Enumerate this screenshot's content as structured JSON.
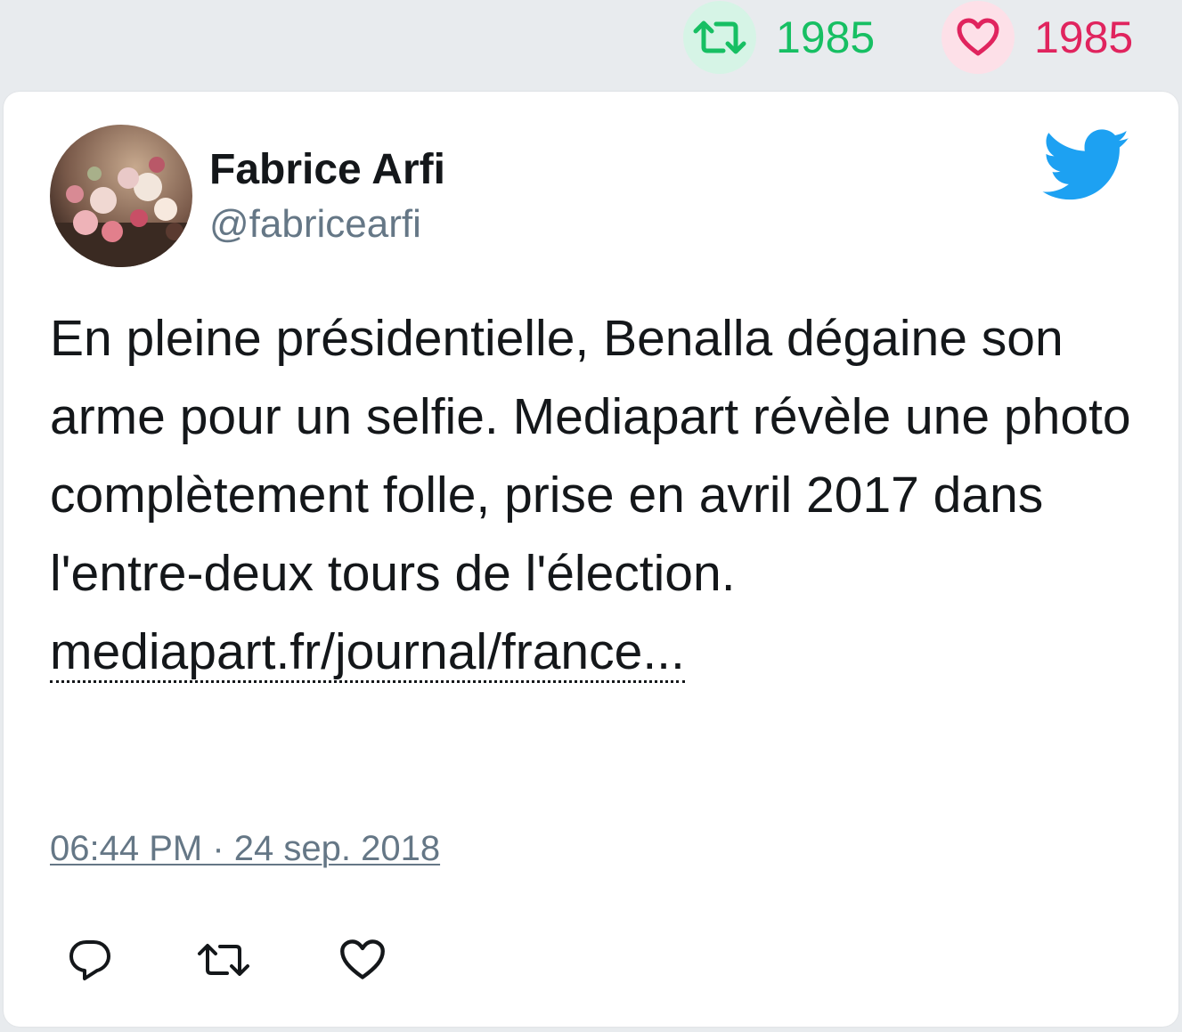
{
  "stats": {
    "retweets": "1985",
    "likes": "1985"
  },
  "tweet": {
    "author_name": "Fabrice Arfi",
    "author_handle": "@fabricearfi",
    "text": "En pleine présidentielle, Benalla dégaine son arme pour un selfie. Mediapart révèle une photo complètement folle, prise en avril 2017 dans l'entre-deux tours de l'élection.",
    "link_text": "mediapart.fr/journal/france...",
    "timestamp": "06:44 PM · 24 sep. 2018"
  },
  "icons": {
    "retweet_stat": "retweet-icon",
    "like_stat": "heart-icon",
    "brand": "twitter-bird-icon",
    "reply_action": "reply-icon",
    "retweet_action": "retweet-icon",
    "like_action": "heart-icon"
  },
  "colors": {
    "retweet_green": "#17bf63",
    "like_red": "#e0245e",
    "twitter_blue": "#1da1f2",
    "secondary_text": "#657786",
    "primary_text": "#14171a"
  }
}
